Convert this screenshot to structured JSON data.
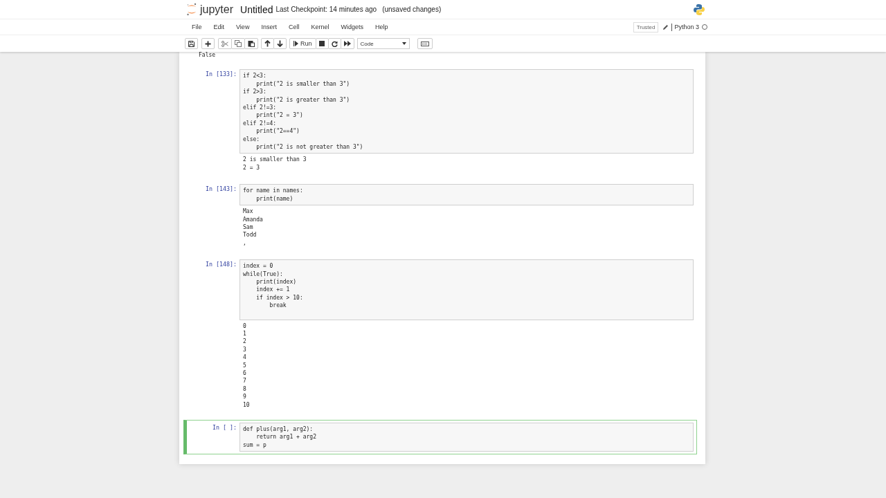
{
  "header": {
    "logo_text": "jupyter",
    "title": "Untitled",
    "checkpoint": "Last Checkpoint: 14 minutes ago",
    "unsaved": "(unsaved changes)"
  },
  "menu": [
    "File",
    "Edit",
    "View",
    "Insert",
    "Cell",
    "Kernel",
    "Widgets",
    "Help"
  ],
  "kernel_area": {
    "trusted": "Trusted",
    "kernel": "Python 3",
    "busy": false
  },
  "toolbar": {
    "run_label": "Run",
    "cell_type": "Code"
  },
  "top_output": [
    "False"
  ],
  "cells": [
    {
      "prompt": "In [133]:",
      "selected": false,
      "code": [
        "if 2<3:",
        "    print(\"2 is smaller than 3\")",
        "if 2>3:",
        "    print(\"2 is greater than 3\")",
        "elif 2!=3:",
        "    print(\"2 = 3\")",
        "elif 2!=4:",
        "    print(\"2==4\")",
        "else:",
        "    print(\"2 is not greater than 3\")"
      ],
      "output": [
        "2 is smaller than 3",
        "2 = 3"
      ]
    },
    {
      "prompt": "In [143]:",
      "selected": false,
      "code": [
        "for name in names:",
        "    print(name)"
      ],
      "output": [
        "Max",
        "Amanda",
        "Sam",
        "Todd",
        ","
      ]
    },
    {
      "prompt": "In [148]:",
      "selected": false,
      "code": [
        "index = 0",
        "while(True):",
        "    print(index)",
        "    index += 1",
        "    if index > 10:",
        "        break"
      ],
      "output": [
        "0",
        "1",
        "2",
        "3",
        "4",
        "5",
        "6",
        "7",
        "8",
        "9",
        "10"
      ]
    },
    {
      "prompt": "In [ ]:",
      "selected": true,
      "code": [
        "def plus(arg1, arg2):",
        "    return arg1 + arg2",
        "sum = p"
      ]
    }
  ]
}
